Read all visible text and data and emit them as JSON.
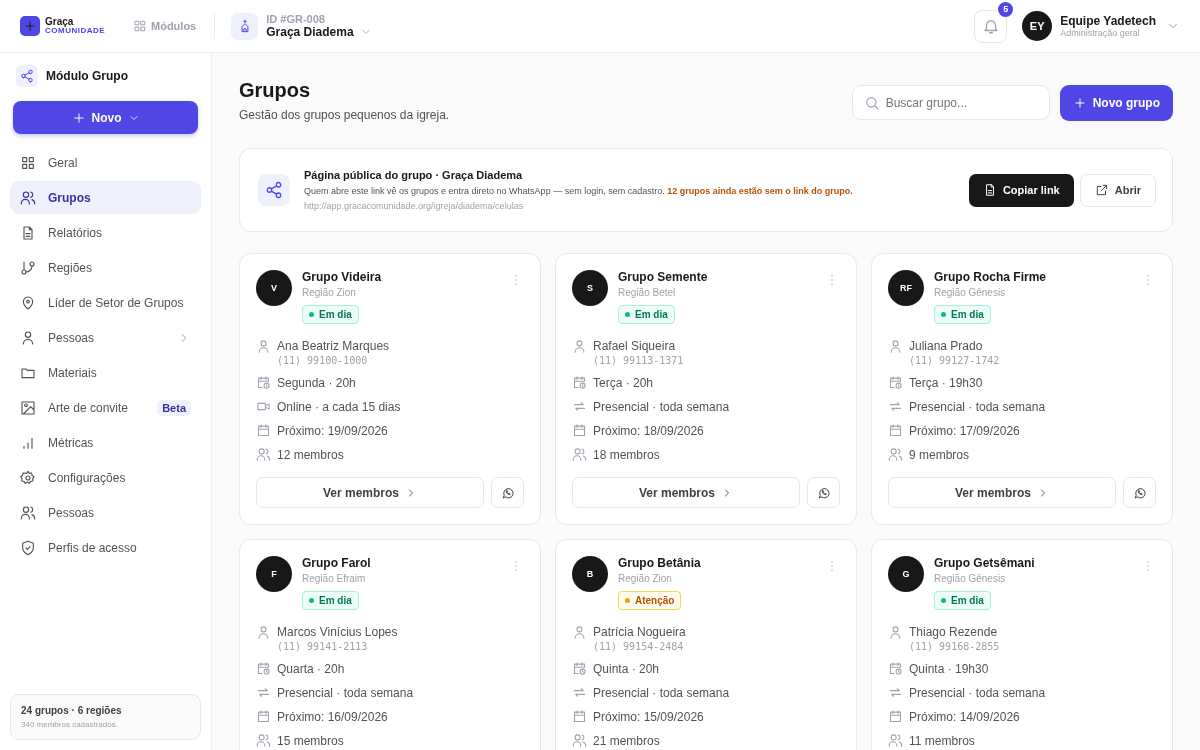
{
  "topbar": {
    "logo": {
      "name": "Graça",
      "tagline": "COMUNIDADE"
    },
    "modules_label": "Módulos",
    "church": {
      "id": "ID #GR-008",
      "name": "Graça Diadema"
    },
    "notifications": "5",
    "user": {
      "initials": "EY",
      "name": "Equipe Yadetech",
      "role": "Administração geral"
    }
  },
  "sidebar": {
    "module": "Módulo Grupo",
    "new_button": "Novo",
    "items": [
      {
        "label": "Geral",
        "selected": false
      },
      {
        "label": "Grupos",
        "selected": true
      },
      {
        "label": "Relatórios",
        "selected": false
      },
      {
        "label": "Regiões",
        "selected": false
      },
      {
        "label": "Líder de Setor de Grupos",
        "selected": false
      },
      {
        "label": "Pessoas",
        "selected": false,
        "has_submenu": true
      },
      {
        "label": "Materiais",
        "selected": false
      },
      {
        "label": "Arte de convite",
        "selected": false,
        "badge": "Beta"
      },
      {
        "label": "Métricas",
        "selected": false
      },
      {
        "label": "Configurações",
        "selected": false
      },
      {
        "label": "Pessoas",
        "selected": false
      },
      {
        "label": "Perfis de acesso",
        "selected": false
      }
    ],
    "summary": {
      "title": "24 grupos · 6 regiões",
      "subtitle": "340 membros cadastrados."
    }
  },
  "page": {
    "title": "Grupos",
    "subtitle": "Gestão dos grupos pequenos da igreja.",
    "search": {
      "placeholder": "Buscar grupo..."
    },
    "new_button": "Novo grupo"
  },
  "public_link": {
    "title": "Página pública do grupo · Graça Diadema",
    "text": "Quem abre este link vê os grupos e entra direto no WhatsApp — sem login, sem cadastro. **12 grupos ainda estão sem o link do grupo.**",
    "url": "http://app.gracacomunidade.org/igreja/diadema/celulas",
    "copy_button": "Copiar link",
    "open_button": "Abrir"
  },
  "groups": [
    {
      "initial": "V",
      "name": "Grupo Videira",
      "region": "Região Zion",
      "status": {
        "label": "Em dia",
        "kind": "ok"
      },
      "leader": "Ana Beatriz Marques",
      "phone": "(11) 99100-1000",
      "schedule": "Segunda · 20h",
      "mode": {
        "kind": "online",
        "text": "Online · a cada 15 dias"
      },
      "next": "Próximo: 19/09/2026",
      "members": "12 membros",
      "button": "Ver membros"
    },
    {
      "initial": "S",
      "name": "Grupo Semente",
      "region": "Região Betel",
      "status": {
        "label": "Em dia",
        "kind": "ok"
      },
      "leader": "Rafael Siqueira",
      "phone": "(11) 99113-1371",
      "schedule": "Terça · 20h",
      "mode": {
        "kind": "presencial",
        "text": "Presencial · toda semana"
      },
      "next": "Próximo: 18/09/2026",
      "members": "18 membros",
      "button": "Ver membros"
    },
    {
      "initial": "RF",
      "name": "Grupo Rocha Firme",
      "region": "Região Gênesis",
      "status": {
        "label": "Em dia",
        "kind": "ok"
      },
      "leader": "Juliana Prado",
      "phone": "(11) 99127-1742",
      "schedule": "Terça · 19h30",
      "mode": {
        "kind": "presencial",
        "text": "Presencial · toda semana"
      },
      "next": "Próximo: 17/09/2026",
      "members": "9 membros",
      "button": "Ver membros"
    },
    {
      "initial": "F",
      "name": "Grupo Farol",
      "region": "Região Efraim",
      "status": {
        "label": "Em dia",
        "kind": "ok"
      },
      "leader": "Marcos Vinícius Lopes",
      "phone": "(11) 99141-2113",
      "schedule": "Quarta · 20h",
      "mode": {
        "kind": "presencial",
        "text": "Presencial · toda semana"
      },
      "next": "Próximo: 16/09/2026",
      "members": "15 membros"
    },
    {
      "initial": "B",
      "name": "Grupo Betânia",
      "region": "Região Zion",
      "status": {
        "label": "Atenção",
        "kind": "warn"
      },
      "leader": "Patrícia Nogueira",
      "phone": "(11) 99154-2484",
      "schedule": "Quinta · 20h",
      "mode": {
        "kind": "presencial",
        "text": "Presencial · toda semana"
      },
      "next": "Próximo: 15/09/2026",
      "members": "21 membros"
    },
    {
      "initial": "G",
      "name": "Grupo Getsêmani",
      "region": "Região Gênesis",
      "status": {
        "label": "Em dia",
        "kind": "ok"
      },
      "leader": "Thiago Rezende",
      "phone": "(11) 99168-2855",
      "schedule": "Quinta · 19h30",
      "mode": {
        "kind": "presencial",
        "text": "Presencial · toda semana"
      },
      "next": "Próximo: 14/09/2026",
      "members": "11 membros"
    }
  ]
}
